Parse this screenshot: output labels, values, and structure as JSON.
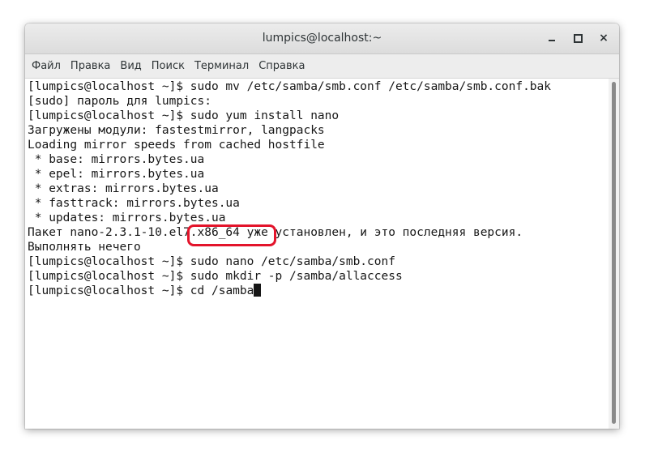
{
  "window": {
    "title": "lumpics@localhost:~",
    "buttons": {
      "minimize": "minimize-icon",
      "maximize": "maximize-icon",
      "close": "×"
    }
  },
  "menu": {
    "items": [
      "Файл",
      "Правка",
      "Вид",
      "Поиск",
      "Терминал",
      "Справка"
    ]
  },
  "terminal": {
    "lines": [
      "[lumpics@localhost ~]$ sudo mv /etc/samba/smb.conf /etc/samba/smb.conf.bak",
      "[sudo] пароль для lumpics:",
      "[lumpics@localhost ~]$ sudo yum install nano",
      "Загружены модули: fastestmirror, langpacks",
      "Loading mirror speeds from cached hostfile",
      " * base: mirrors.bytes.ua",
      " * epel: mirrors.bytes.ua",
      " * extras: mirrors.bytes.ua",
      " * fasttrack: mirrors.bytes.ua",
      " * updates: mirrors.bytes.ua",
      "Пакет nano-2.3.1-10.el7.x86_64 уже установлен, и это последняя версия.",
      "Выполнять нечего",
      "[lumpics@localhost ~]$ sudo nano /etc/samba/smb.conf",
      "[lumpics@localhost ~]$ sudo mkdir -p /samba/allaccess"
    ],
    "prompt": "[lumpics@localhost ~]$ ",
    "current_input": "cd /samba"
  },
  "colors": {
    "highlight": "#e3142b",
    "terminal_fg": "#171717",
    "terminal_bg": "#ffffff"
  }
}
